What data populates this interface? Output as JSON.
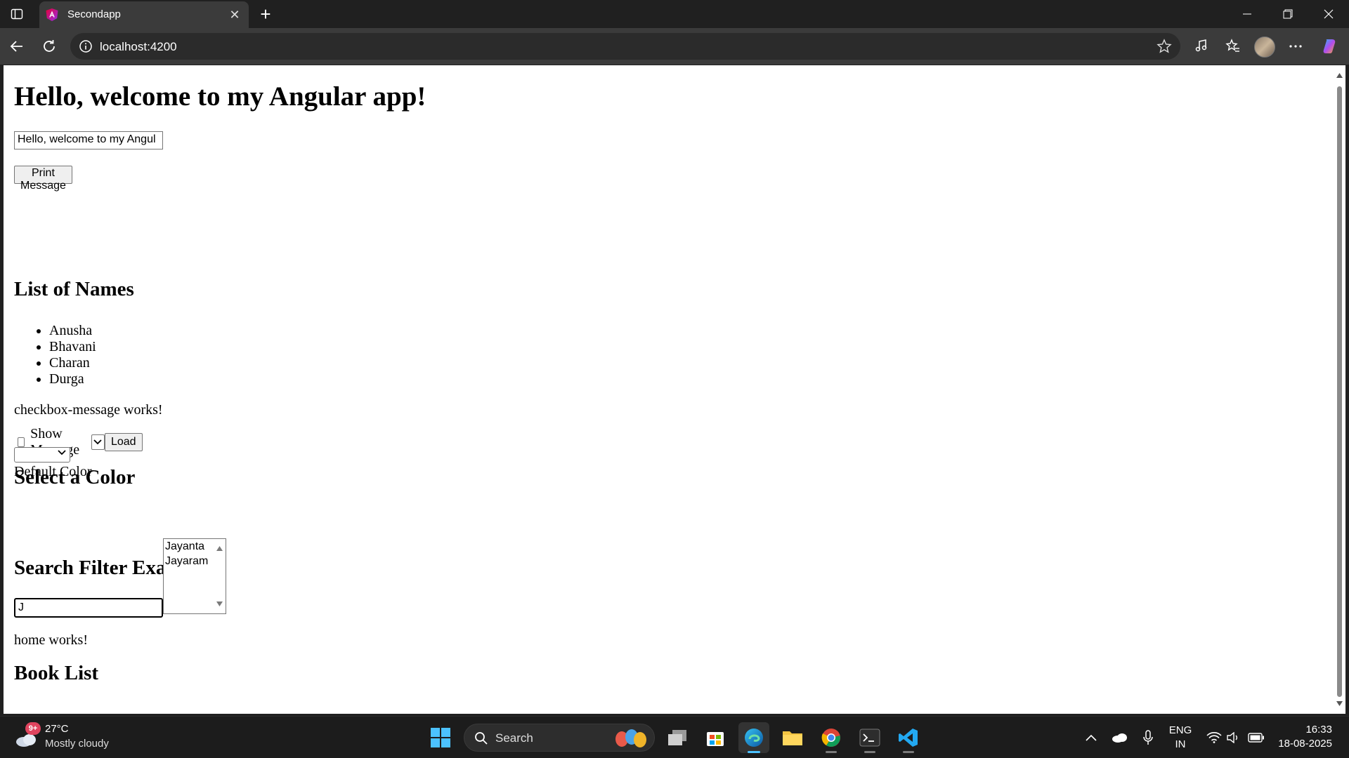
{
  "browser": {
    "tab_title": "Secondapp",
    "url": "localhost:4200"
  },
  "page": {
    "heading": "Hello, welcome to my Angular app!",
    "message_input_value": "Hello, welcome to my Angul",
    "print_button": "Print Message",
    "list_heading": "List of Names",
    "names": [
      "Anusha",
      "Bhavani",
      "Charan",
      "Durga"
    ],
    "checkbox_component_text": "checkbox-message works!",
    "show_message_label": "Show Message",
    "load_button": "Load",
    "color_heading": "Select a Color",
    "color_text": "Default Color",
    "search_heading": "Search Filter Example",
    "search_input_value": "J",
    "search_results": [
      "Jayanta",
      "Jayaram"
    ],
    "home_text": "home works!",
    "book_heading": "Book List"
  },
  "taskbar": {
    "weather_temp": "27°C",
    "weather_desc": "Mostly cloudy",
    "weather_badge": "9+",
    "search_label": "Search",
    "lang_top": "ENG",
    "lang_bottom": "IN",
    "time": "16:33",
    "date": "18-08-2025"
  },
  "icons": {
    "tab_favicon": "angular-logo-icon",
    "accent_color": "#4cc2ff"
  }
}
